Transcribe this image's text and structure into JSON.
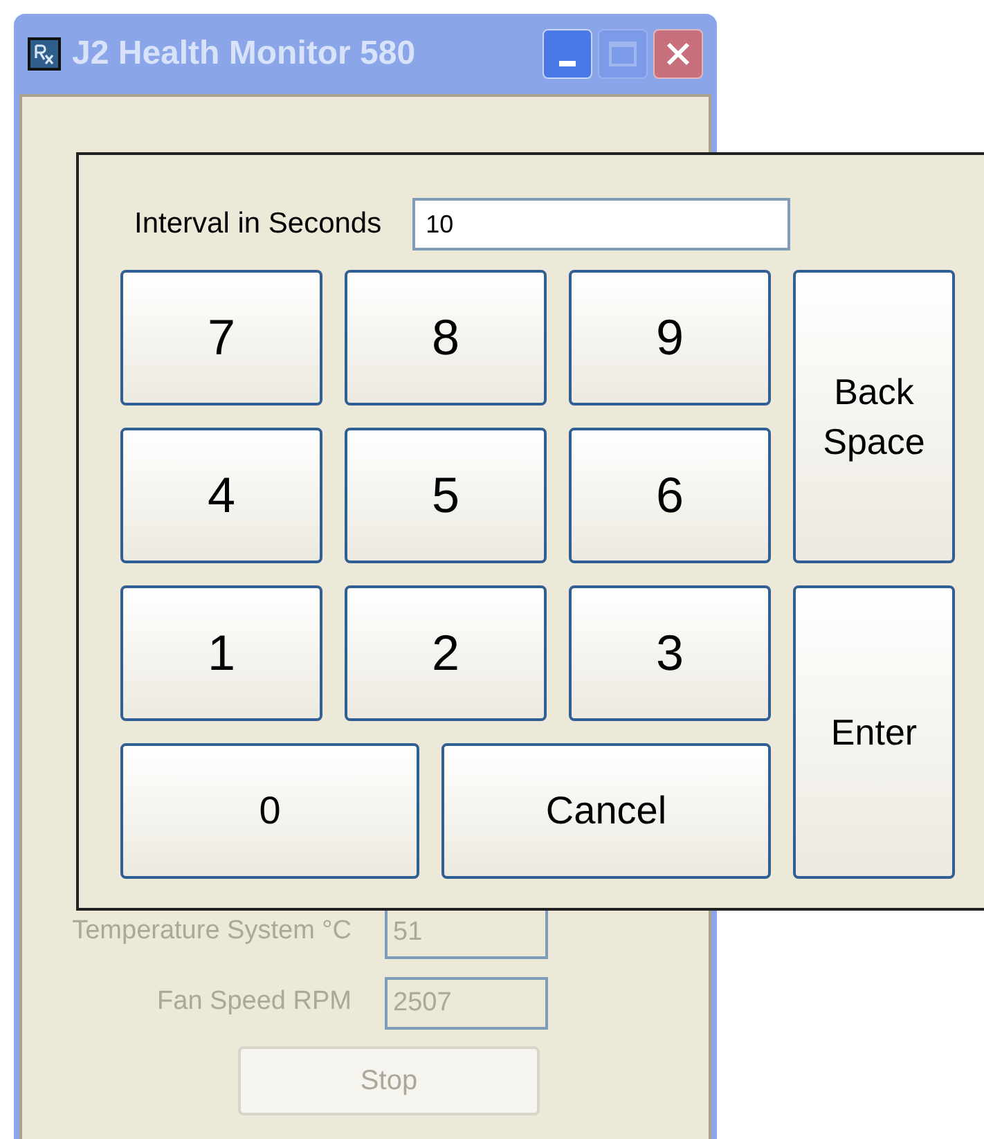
{
  "window": {
    "title": "J2 Health Monitor 580",
    "active": false
  },
  "readings": [
    {
      "label": "Temperature System °C",
      "value": "51",
      "disabled": true
    },
    {
      "label": "Fan Speed RPM",
      "value": "2507",
      "disabled": true
    }
  ],
  "stop_button": {
    "label": "Stop",
    "disabled": true
  },
  "keypad": {
    "field_label": "Interval in Seconds",
    "value": "10",
    "keys": [
      {
        "label": "7",
        "kind": "digit"
      },
      {
        "label": "8",
        "kind": "digit"
      },
      {
        "label": "9",
        "kind": "digit"
      },
      {
        "label": "Back Space",
        "kind": "tall"
      },
      {
        "label": "4",
        "kind": "digit"
      },
      {
        "label": "5",
        "kind": "digit"
      },
      {
        "label": "6",
        "kind": "digit"
      },
      {
        "label": "1",
        "kind": "digit"
      },
      {
        "label": "2",
        "kind": "digit"
      },
      {
        "label": "3",
        "kind": "digit"
      },
      {
        "label": "Enter",
        "kind": "tall"
      },
      {
        "label": "0",
        "kind": "wide"
      },
      {
        "label": "Cancel",
        "kind": "wide"
      }
    ]
  }
}
